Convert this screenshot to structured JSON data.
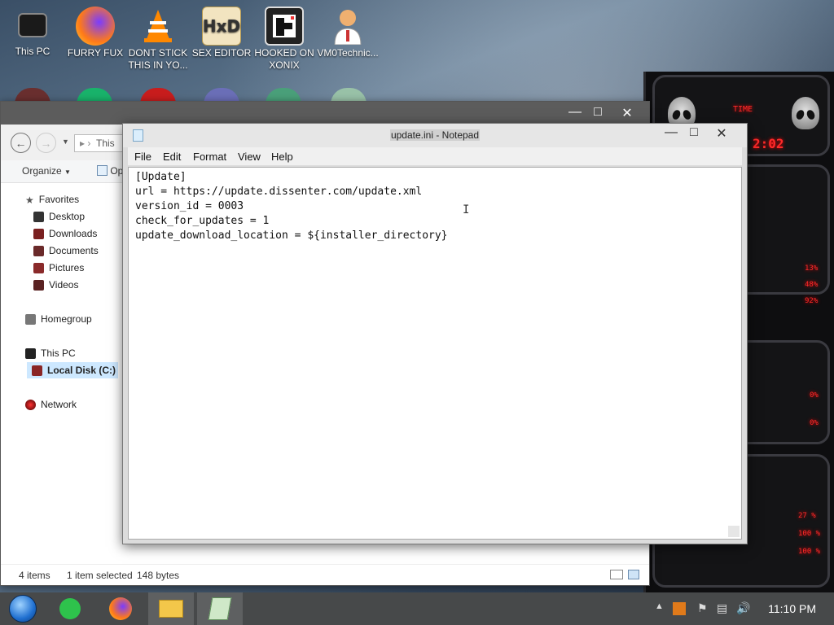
{
  "desktop": {
    "icons": [
      {
        "label": "This PC",
        "icon": "monitor-icon"
      },
      {
        "label": "FURRY FUX",
        "icon": "firefox-icon"
      },
      {
        "label": "DONT STICK THIS IN YO...",
        "icon": "vlc-cone-icon"
      },
      {
        "label": "SEX EDITOR",
        "icon": "hxd-icon"
      },
      {
        "label": "HOOKED ON XONIX",
        "icon": "xonix-icon"
      },
      {
        "label": "VM0Technic...",
        "icon": "doctor-icon"
      }
    ]
  },
  "explorer": {
    "address_text": "This",
    "toolbar": {
      "organize_label": "Organize",
      "open_label": "Op"
    },
    "sidebar": {
      "favorites": "Favorites",
      "desktop": "Desktop",
      "downloads": "Downloads",
      "documents": "Documents",
      "pictures": "Pictures",
      "videos": "Videos",
      "homegroup": "Homegroup",
      "this_pc": "This PC",
      "local_disk": "Local Disk (C:)",
      "network": "Network"
    },
    "status": {
      "items": "4 items",
      "selected": "1 item selected",
      "size": "148 bytes"
    }
  },
  "notepad": {
    "title": "update.ini - Notepad",
    "menu": {
      "file": "File",
      "edit": "Edit",
      "format": "Format",
      "view": "View",
      "help": "Help"
    },
    "lines": [
      "[Update]",
      "url = https://update.dissenter.com/update.xml",
      "version_id = 0003",
      "check_for_updates = 1",
      "update_download_location = ${installer_directory}"
    ]
  },
  "gadget": {
    "time_label": "TIME",
    "time_value": "2:02",
    "readouts": [
      "13%",
      "48%",
      "92%",
      "0%",
      "0%",
      "27 %",
      "100 %",
      "100 %"
    ]
  },
  "taskbar": {
    "clock": "11:10 PM"
  },
  "colors": {
    "taskbar": "#47494a",
    "gadget_red": "#ff2a2a",
    "selection": "#cde8ff"
  }
}
